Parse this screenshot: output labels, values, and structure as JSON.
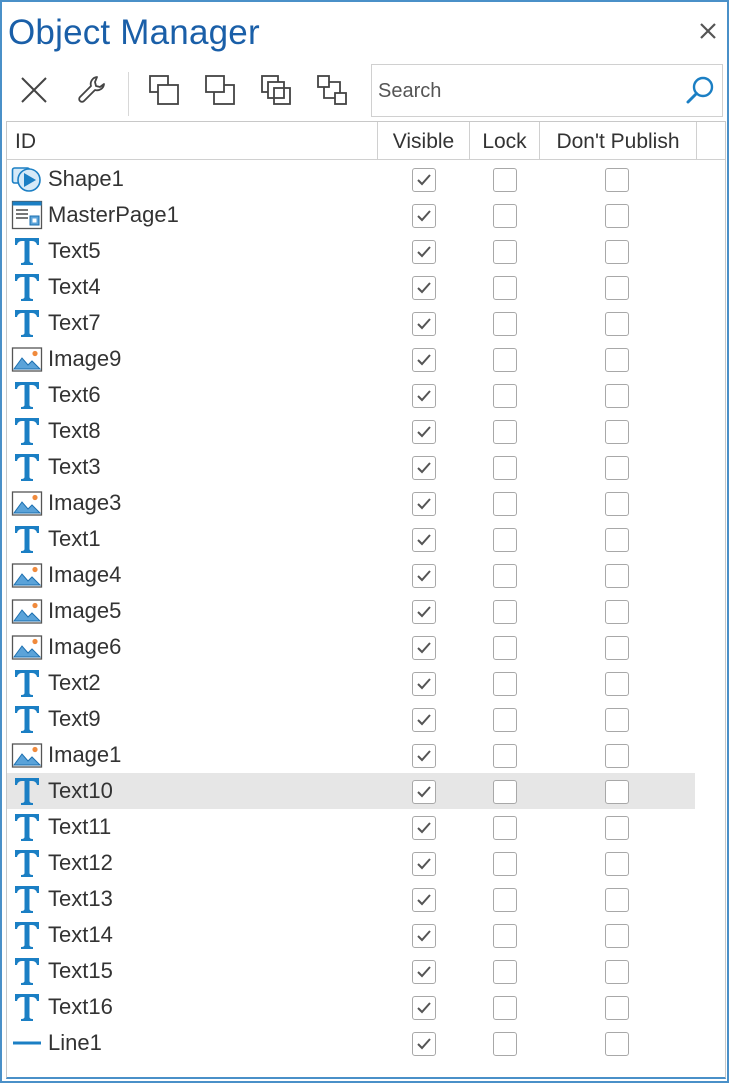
{
  "window": {
    "title": "Object Manager"
  },
  "toolbar": {
    "buttons": [
      "delete-icon",
      "wrench-icon",
      "bring-to-front-icon",
      "send-to-back-icon",
      "bring-forward-icon",
      "send-backward-icon"
    ]
  },
  "search": {
    "placeholder": "Search",
    "value": ""
  },
  "table": {
    "headers": {
      "id": "ID",
      "visible": "Visible",
      "lock": "Lock",
      "dont_publish": "Don't Publish"
    },
    "rows": [
      {
        "id": "Shape1",
        "type": "shape",
        "visible": true,
        "lock": false,
        "dont_publish": false,
        "selected": false
      },
      {
        "id": "MasterPage1",
        "type": "masterpage",
        "visible": true,
        "lock": false,
        "dont_publish": false,
        "selected": false
      },
      {
        "id": "Text5",
        "type": "text",
        "visible": true,
        "lock": false,
        "dont_publish": false,
        "selected": false
      },
      {
        "id": "Text4",
        "type": "text",
        "visible": true,
        "lock": false,
        "dont_publish": false,
        "selected": false
      },
      {
        "id": "Text7",
        "type": "text",
        "visible": true,
        "lock": false,
        "dont_publish": false,
        "selected": false
      },
      {
        "id": "Image9",
        "type": "image",
        "visible": true,
        "lock": false,
        "dont_publish": false,
        "selected": false
      },
      {
        "id": "Text6",
        "type": "text",
        "visible": true,
        "lock": false,
        "dont_publish": false,
        "selected": false
      },
      {
        "id": "Text8",
        "type": "text",
        "visible": true,
        "lock": false,
        "dont_publish": false,
        "selected": false
      },
      {
        "id": "Text3",
        "type": "text",
        "visible": true,
        "lock": false,
        "dont_publish": false,
        "selected": false
      },
      {
        "id": "Image3",
        "type": "image",
        "visible": true,
        "lock": false,
        "dont_publish": false,
        "selected": false
      },
      {
        "id": "Text1",
        "type": "text",
        "visible": true,
        "lock": false,
        "dont_publish": false,
        "selected": false
      },
      {
        "id": "Image4",
        "type": "image",
        "visible": true,
        "lock": false,
        "dont_publish": false,
        "selected": false
      },
      {
        "id": "Image5",
        "type": "image",
        "visible": true,
        "lock": false,
        "dont_publish": false,
        "selected": false
      },
      {
        "id": "Image6",
        "type": "image",
        "visible": true,
        "lock": false,
        "dont_publish": false,
        "selected": false
      },
      {
        "id": "Text2",
        "type": "text",
        "visible": true,
        "lock": false,
        "dont_publish": false,
        "selected": false
      },
      {
        "id": "Text9",
        "type": "text",
        "visible": true,
        "lock": false,
        "dont_publish": false,
        "selected": false
      },
      {
        "id": "Image1",
        "type": "image",
        "visible": true,
        "lock": false,
        "dont_publish": false,
        "selected": false
      },
      {
        "id": "Text10",
        "type": "text",
        "visible": true,
        "lock": false,
        "dont_publish": false,
        "selected": true
      },
      {
        "id": "Text11",
        "type": "text",
        "visible": true,
        "lock": false,
        "dont_publish": false,
        "selected": false
      },
      {
        "id": "Text12",
        "type": "text",
        "visible": true,
        "lock": false,
        "dont_publish": false,
        "selected": false
      },
      {
        "id": "Text13",
        "type": "text",
        "visible": true,
        "lock": false,
        "dont_publish": false,
        "selected": false
      },
      {
        "id": "Text14",
        "type": "text",
        "visible": true,
        "lock": false,
        "dont_publish": false,
        "selected": false
      },
      {
        "id": "Text15",
        "type": "text",
        "visible": true,
        "lock": false,
        "dont_publish": false,
        "selected": false
      },
      {
        "id": "Text16",
        "type": "text",
        "visible": true,
        "lock": false,
        "dont_publish": false,
        "selected": false
      },
      {
        "id": "Line1",
        "type": "line",
        "visible": true,
        "lock": false,
        "dont_publish": false,
        "selected": false
      }
    ]
  },
  "colors": {
    "accent": "#1a5fa8",
    "border": "#4a90c8",
    "icon_blue": "#1b7fc4",
    "selected_row": "#e6e6e6"
  }
}
